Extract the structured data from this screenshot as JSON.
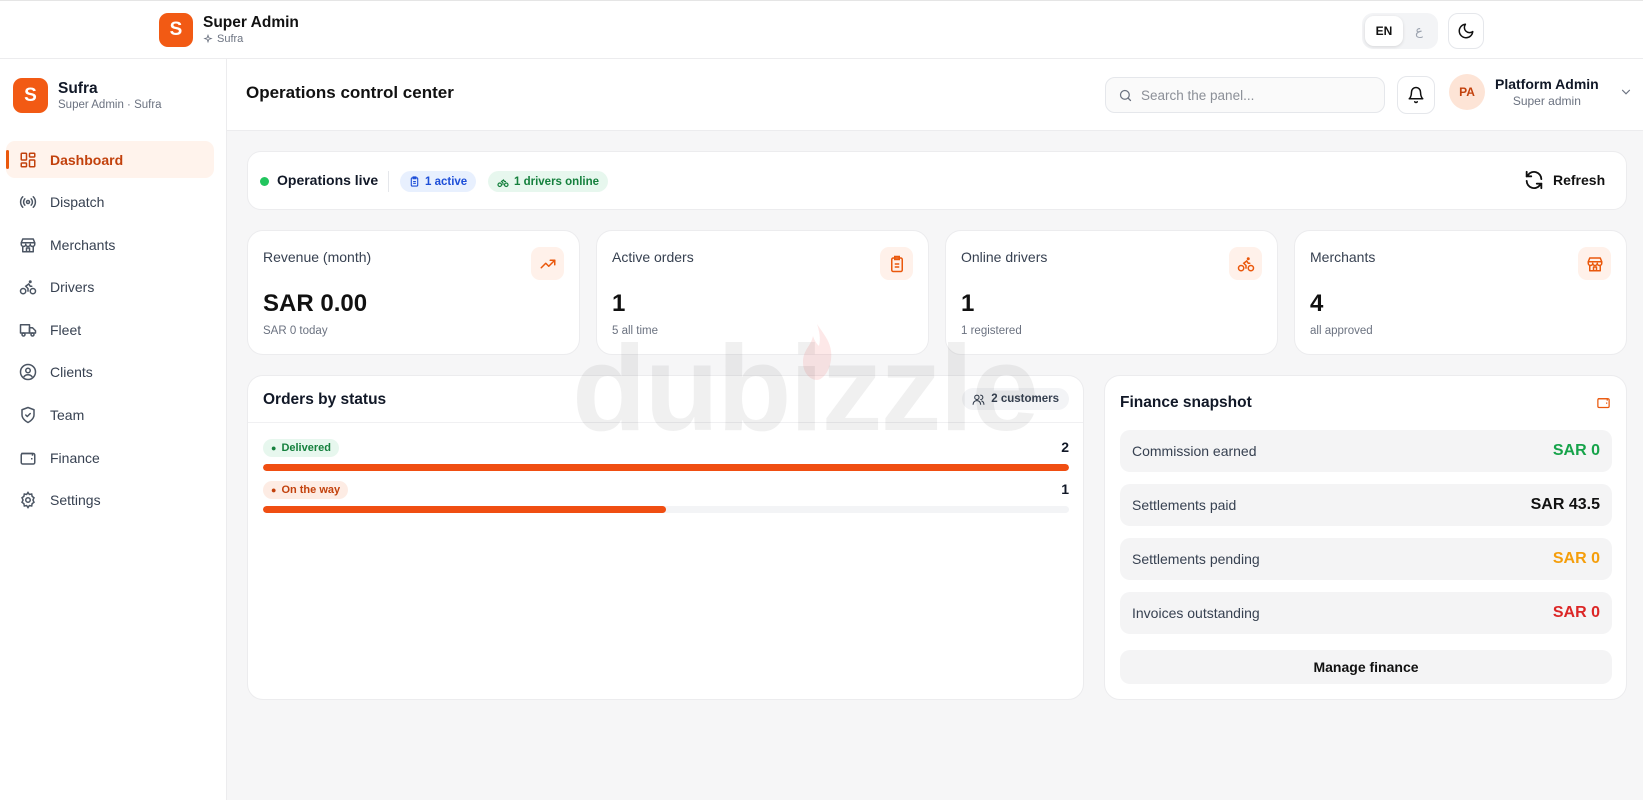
{
  "topbar": {
    "logo_letter": "S",
    "title": "Super Admin",
    "subtitle": "Sufra",
    "lang_active": "EN",
    "lang_other": "ع"
  },
  "sidebar": {
    "logo_letter": "S",
    "title": "Sufra",
    "subtitle": "Super Admin · Sufra",
    "items": [
      {
        "label": "Dashboard",
        "icon": "dashboard-icon"
      },
      {
        "label": "Dispatch",
        "icon": "broadcast-icon"
      },
      {
        "label": "Merchants",
        "icon": "store-icon"
      },
      {
        "label": "Drivers",
        "icon": "bike-icon"
      },
      {
        "label": "Fleet",
        "icon": "truck-icon"
      },
      {
        "label": "Clients",
        "icon": "user-circle-icon"
      },
      {
        "label": "Team",
        "icon": "shield-icon"
      },
      {
        "label": "Finance",
        "icon": "wallet-icon"
      },
      {
        "label": "Settings",
        "icon": "gear-icon"
      }
    ]
  },
  "header": {
    "title": "Operations control center",
    "search_placeholder": "Search the panel...",
    "user_initials": "PA",
    "user_name": "Platform Admin",
    "user_role": "Super admin"
  },
  "opsbar": {
    "live_label": "Operations live",
    "active_pill": "1 active",
    "drivers_pill": "1 drivers online",
    "refresh_label": "Refresh"
  },
  "stats": [
    {
      "label": "Revenue (month)",
      "value": "SAR 0.00",
      "sub": "SAR 0 today",
      "icon": "trending-up-icon"
    },
    {
      "label": "Active orders",
      "value": "1",
      "sub": "5 all time",
      "icon": "clipboard-icon"
    },
    {
      "label": "Online drivers",
      "value": "1",
      "sub": "1 registered",
      "icon": "bike-icon"
    },
    {
      "label": "Merchants",
      "value": "4",
      "sub": "all approved",
      "icon": "store-icon"
    }
  ],
  "orders": {
    "title": "Orders by status",
    "customers_pill": "2 customers",
    "rows": [
      {
        "label": "Delivered",
        "count": "2",
        "fraction": 1.0,
        "badge_bg": "#e7f7ee",
        "badge_color": "#15803d"
      },
      {
        "label": "On the way",
        "count": "1",
        "fraction": 0.5,
        "badge_bg": "#fdece4",
        "badge_color": "#c2410c"
      }
    ]
  },
  "watermark": "dubizzle",
  "finance": {
    "title": "Finance snapshot",
    "rows": [
      {
        "label": "Commission earned",
        "value": "SAR 0",
        "color": "#16a34a"
      },
      {
        "label": "Settlements paid",
        "value": "SAR 43.5",
        "color": "#111111"
      },
      {
        "label": "Settlements pending",
        "value": "SAR 0",
        "color": "#f59e0b"
      },
      {
        "label": "Invoices outstanding",
        "value": "SAR 0",
        "color": "#dc2626"
      }
    ],
    "button_label": "Manage finance"
  },
  "colors": {
    "accent": "#f25a14",
    "live": "#22c55e"
  }
}
